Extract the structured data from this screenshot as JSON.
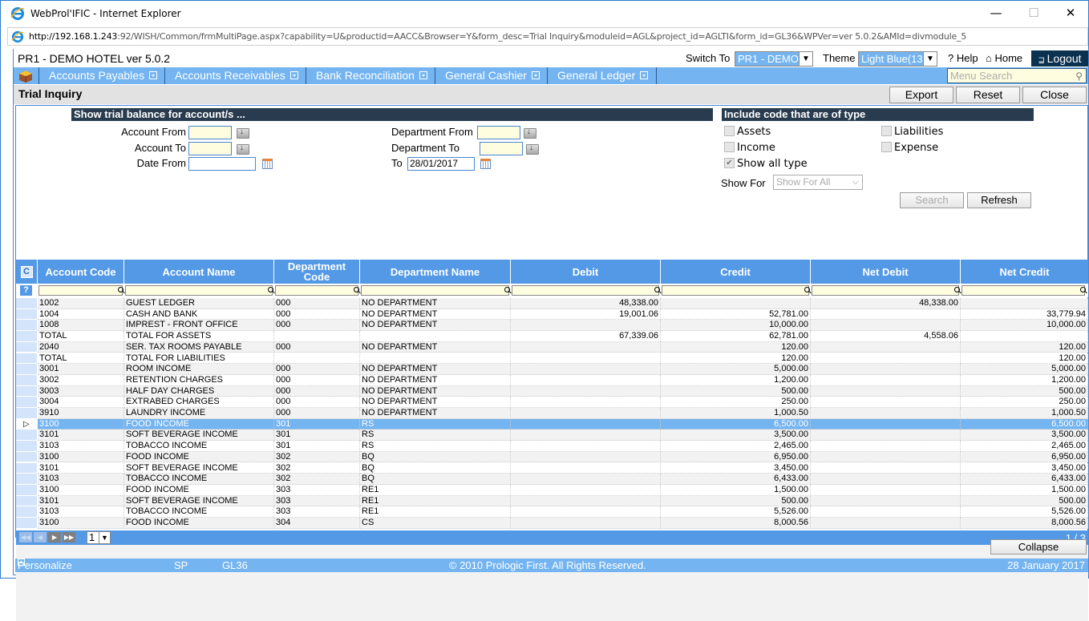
{
  "window": {
    "title": "WebProl'IFIC - Internet Explorer",
    "controls": {
      "minimize": "—",
      "maximize": "☐",
      "close": "✕"
    }
  },
  "address_bar": {
    "url_host": "http://192.168.1.243",
    "url_rest": ":92/WISH/Common/frmMultiPage.aspx?capability=U&productid=AACC&Browser=Y&form_desc=Trial Inquiry&moduleid=AGL&project_id=AGLTI&form_id=GL36&WPVer=ver 5.0.2&AMId=divmodule_5"
  },
  "header": {
    "app_title": "PR1 - DEMO HOTEL ver 5.0.2",
    "switch_to_label": "Switch To",
    "switch_to_value": "PR1 - DEMO",
    "theme_label": "Theme",
    "theme_value": "Light Blue(13",
    "help": "? Help",
    "home": "⌂ Home",
    "logout": "Logout"
  },
  "menu": {
    "items": [
      "Accounts Payables",
      "Accounts Receivables",
      "Bank Reconciliation",
      "General Cashier",
      "General Ledger"
    ],
    "search_placeholder": "Menu Search"
  },
  "page": {
    "title": "Trial Inquiry",
    "buttons": {
      "export": "Export",
      "reset": "Reset",
      "close": "Close"
    }
  },
  "filters": {
    "left_heading": "Show trial balance for account/s ...",
    "account_from_label": "Account From",
    "account_from_value": "",
    "account_to_label": "Account To",
    "account_to_value": "",
    "date_from_label": "Date From",
    "date_from_value": "",
    "department_from_label": "Department From",
    "department_from_value": "",
    "department_to_label": "Department To",
    "department_to_value": "",
    "to_label": "To",
    "to_value": "28/01/2017",
    "right_heading": "Include code that are of type",
    "types": [
      {
        "label": "Assets",
        "checked": false
      },
      {
        "label": "Liabilities",
        "checked": false
      },
      {
        "label": "Income",
        "checked": false
      },
      {
        "label": "Expense",
        "checked": false
      },
      {
        "label": "Show all type",
        "checked": true
      }
    ],
    "show_for_label": "Show For",
    "show_for_value": "Show For All",
    "search_button": "Search",
    "refresh_button": "Refresh"
  },
  "grid": {
    "columns": [
      "Account Code",
      "Account Name",
      "Department Code",
      "Department Name",
      "Debit",
      "Credit",
      "Net Debit",
      "Net Credit"
    ],
    "rows": [
      [
        "1002",
        "GUEST LEDGER",
        "000",
        "NO DEPARTMENT",
        "48,338.00",
        "",
        "48,338.00",
        ""
      ],
      [
        "1004",
        "CASH AND BANK",
        "000",
        "NO DEPARTMENT",
        "19,001.06",
        "52,781.00",
        "",
        "33,779.94"
      ],
      [
        "1008",
        "IMPREST - FRONT OFFICE",
        "000",
        "NO DEPARTMENT",
        "",
        "10,000.00",
        "",
        "10,000.00"
      ],
      [
        "TOTAL",
        "TOTAL FOR ASSETS",
        "",
        "",
        "67,339.06",
        "62,781.00",
        "4,558.06",
        ""
      ],
      [
        "2040",
        "SER. TAX ROOMS PAYABLE",
        "000",
        "NO DEPARTMENT",
        "",
        "120.00",
        "",
        "120.00"
      ],
      [
        "TOTAL",
        "TOTAL FOR LIABILITIES",
        "",
        "",
        "",
        "120.00",
        "",
        "120.00"
      ],
      [
        "3001",
        "ROOM INCOME",
        "000",
        "NO DEPARTMENT",
        "",
        "5,000.00",
        "",
        "5,000.00"
      ],
      [
        "3002",
        "RETENTION CHARGES",
        "000",
        "NO DEPARTMENT",
        "",
        "1,200.00",
        "",
        "1,200.00"
      ],
      [
        "3003",
        "HALF DAY CHARGES",
        "000",
        "NO DEPARTMENT",
        "",
        "500.00",
        "",
        "500.00"
      ],
      [
        "3004",
        "EXTRABED CHARGES",
        "000",
        "NO DEPARTMENT",
        "",
        "250.00",
        "",
        "250.00"
      ],
      [
        "3910",
        "LAUNDRY INCOME",
        "000",
        "NO DEPARTMENT",
        "",
        "1,000.50",
        "",
        "1,000.50"
      ],
      [
        "3100",
        "FOOD INCOME",
        "301",
        "RS",
        "",
        "6,500.00",
        "",
        "6,500.00"
      ],
      [
        "3101",
        "SOFT BEVERAGE INCOME",
        "301",
        "RS",
        "",
        "3,500.00",
        "",
        "3,500.00"
      ],
      [
        "3103",
        "TOBACCO INCOME",
        "301",
        "RS",
        "",
        "2,465.00",
        "",
        "2,465.00"
      ],
      [
        "3100",
        "FOOD INCOME",
        "302",
        "BQ",
        "",
        "6,950.00",
        "",
        "6,950.00"
      ],
      [
        "3101",
        "SOFT BEVERAGE INCOME",
        "302",
        "BQ",
        "",
        "3,450.00",
        "",
        "3,450.00"
      ],
      [
        "3103",
        "TOBACCO INCOME",
        "302",
        "BQ",
        "",
        "6,433.00",
        "",
        "6,433.00"
      ],
      [
        "3100",
        "FOOD INCOME",
        "303",
        "RE1",
        "",
        "1,500.00",
        "",
        "1,500.00"
      ],
      [
        "3101",
        "SOFT BEVERAGE INCOME",
        "303",
        "RE1",
        "",
        "500.00",
        "",
        "500.00"
      ],
      [
        "3103",
        "TOBACCO INCOME",
        "303",
        "RE1",
        "",
        "5,526.00",
        "",
        "5,526.00"
      ],
      [
        "3100",
        "FOOD INCOME",
        "304",
        "CS",
        "",
        "8,000.56",
        "",
        "8,000.56"
      ]
    ],
    "selected_row": 11,
    "page_value": "1",
    "page_count": "1 / 3"
  },
  "collapse_button": "Collapse",
  "footer": {
    "personalize": "Personalize",
    "user": "SP",
    "form_id": "GL36",
    "copyright": "© 2010 Prologic First. All Rights Reserved.",
    "date": "28 January 2017"
  }
}
